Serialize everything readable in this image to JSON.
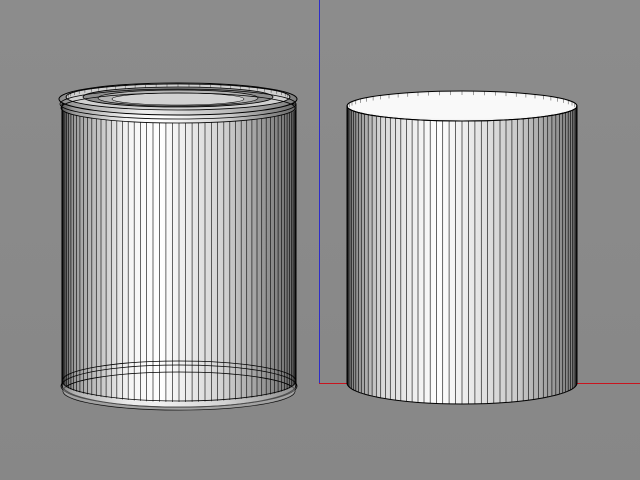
{
  "viewport": {
    "background": "#898989",
    "axes": {
      "x_color": "#c8141e",
      "y_color": "#2d2dc8",
      "show": true
    }
  },
  "objects": [
    {
      "label": "",
      "kind": "paint-can",
      "display": "wireframe-shaded",
      "wire_color": "#000000"
    },
    {
      "label": "",
      "kind": "cylinder",
      "display": "wireframe-shaded",
      "wire_color": "#000000"
    }
  ]
}
